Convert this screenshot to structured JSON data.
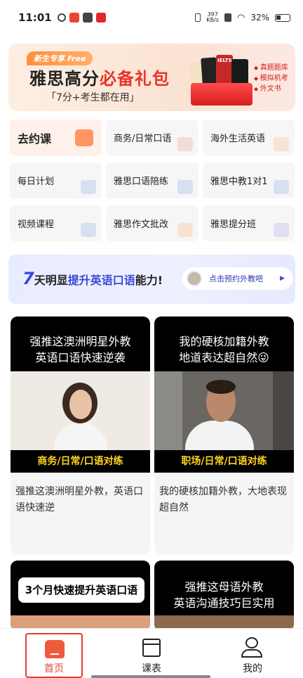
{
  "status_bar": {
    "time": "11:01",
    "net_speed_value": "397",
    "net_speed_unit": "KB/s",
    "battery": "32%"
  },
  "banner": {
    "badge": "新生专享 Free",
    "title_part1": "雅思高分",
    "title_part2": "必备礼包",
    "subtitle": "「7分+考生都在用」",
    "book_label": "IELTS",
    "features": [
      "真题题库",
      "模拟机考",
      "外文书"
    ]
  },
  "grid": {
    "items": [
      {
        "label": "去约课",
        "icon": "calendar-icon",
        "color": "#ff9560"
      },
      {
        "label": "商务/日常口语",
        "icon": "letter-a-icon",
        "color": "#f1a9a0"
      },
      {
        "label": "海外生活英语",
        "icon": "plane-icon",
        "color": "#f6c38a"
      },
      {
        "label": "每日计划",
        "icon": "book-icon",
        "color": "#9ab8e6"
      },
      {
        "label": "雅思口语陪练",
        "icon": "chart-icon",
        "color": "#9ab8e6"
      },
      {
        "label": "雅思中教1对1",
        "icon": "book-icon",
        "color": "#9ab8e6"
      },
      {
        "label": "视频课程",
        "icon": "video-icon",
        "color": "#9ab8e6"
      },
      {
        "label": "雅思作文批改",
        "icon": "image-icon",
        "color": "#f6c38a"
      },
      {
        "label": "雅思提分班",
        "icon": "doc-icon",
        "color": "#b7b4e6"
      }
    ]
  },
  "promo": {
    "number": "7",
    "text1": "天明显",
    "text2": "提升英语口语",
    "text3": "能力!",
    "button_label": "点击预约外教吧"
  },
  "cards": [
    {
      "top_lines": [
        "强推这澳洲明星外教",
        "英语口语快速逆袭"
      ],
      "strip": "商务/日常/口语对练",
      "desc": "强推这澳洲明星外教，英语口语快速逆"
    },
    {
      "top_lines": [
        "我的硬核加籍外教",
        "地道表达超自然😜"
      ],
      "strip": "职场/日常/口语对练",
      "desc": "我的硬核加籍外教，大地表现超自然"
    },
    {
      "top_lines": [
        "3个月快速提升英语口语"
      ]
    },
    {
      "top_lines": [
        "强推这母语外教",
        "英语沟通技巧巨实用"
      ]
    }
  ],
  "tabbar": {
    "items": [
      "首页",
      "课表",
      "我的"
    ]
  },
  "colors": {
    "accent_red": "#e53935",
    "promo_blue": "#3a48d8",
    "strip_yellow": "#ffd21f"
  }
}
